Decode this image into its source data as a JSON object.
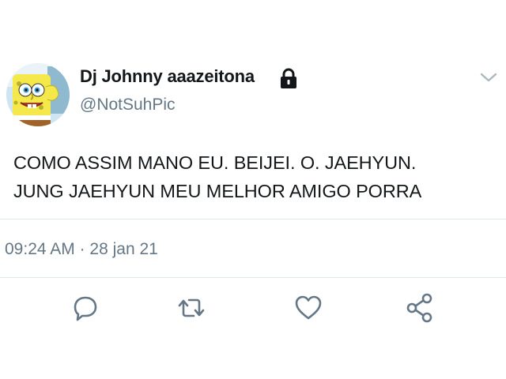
{
  "tweet": {
    "author": {
      "display_name": "Dj Johnny aaazeitona",
      "handle": "@NotSuhPic",
      "protected_icon": "lock-icon",
      "avatar": "spongebob-avatar"
    },
    "menu_icon": "chevron-down-icon",
    "text_lines": [
      "COMO ASSIM MANO EU. BEIJEI. O. JAEHYUN.",
      "JUNG JAEHYUN MEU MELHOR AMIGO PORRA"
    ],
    "time": "09:24 AM",
    "separator": "·",
    "date": "28 jan 21"
  },
  "actions": [
    {
      "icon": "reply-icon"
    },
    {
      "icon": "retweet-icon"
    },
    {
      "icon": "like-icon"
    },
    {
      "icon": "share-icon"
    }
  ],
  "colors": {
    "text": "#14171a",
    "secondary_text": "#657786",
    "icon": "#657786",
    "divider": "#e1e8ed"
  }
}
